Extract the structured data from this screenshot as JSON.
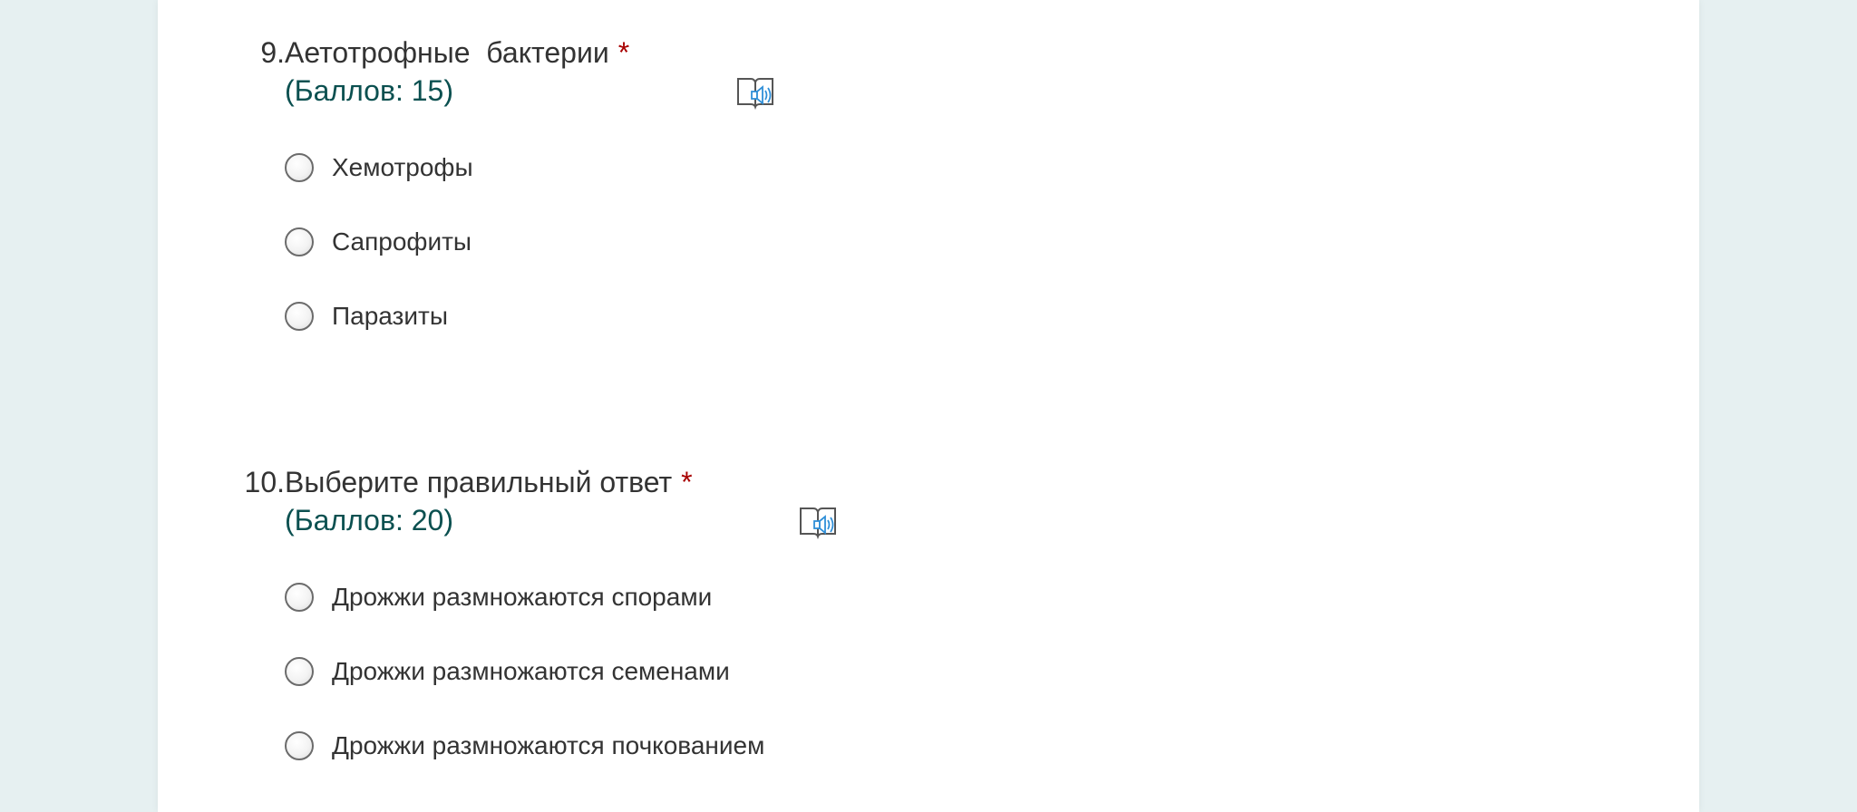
{
  "questions": [
    {
      "number": "9.",
      "title": "Аетотрофные  бактерии",
      "required_mark": "*",
      "points": "(Баллов: 15)",
      "reader_icon": "immersive-reader-icon",
      "options": [
        {
          "label": "Хемотрофы"
        },
        {
          "label": "Сапрофиты"
        },
        {
          "label": "Паразиты"
        }
      ]
    },
    {
      "number": "10.",
      "title": "Выберите правильный ответ",
      "required_mark": "*",
      "points": "(Баллов: 20)",
      "reader_icon": "immersive-reader-icon",
      "options": [
        {
          "label": "Дрожжи размножаются спорами"
        },
        {
          "label": "Дрожжи размножаются семенами"
        },
        {
          "label": "Дрожжи размножаются почкованием"
        }
      ]
    }
  ],
  "colors": {
    "background": "#e6f0f1",
    "card": "#ffffff",
    "text": "#333333",
    "points": "#0b5050",
    "required": "#a80000",
    "reader_icon_accent": "#2f8fd8"
  }
}
